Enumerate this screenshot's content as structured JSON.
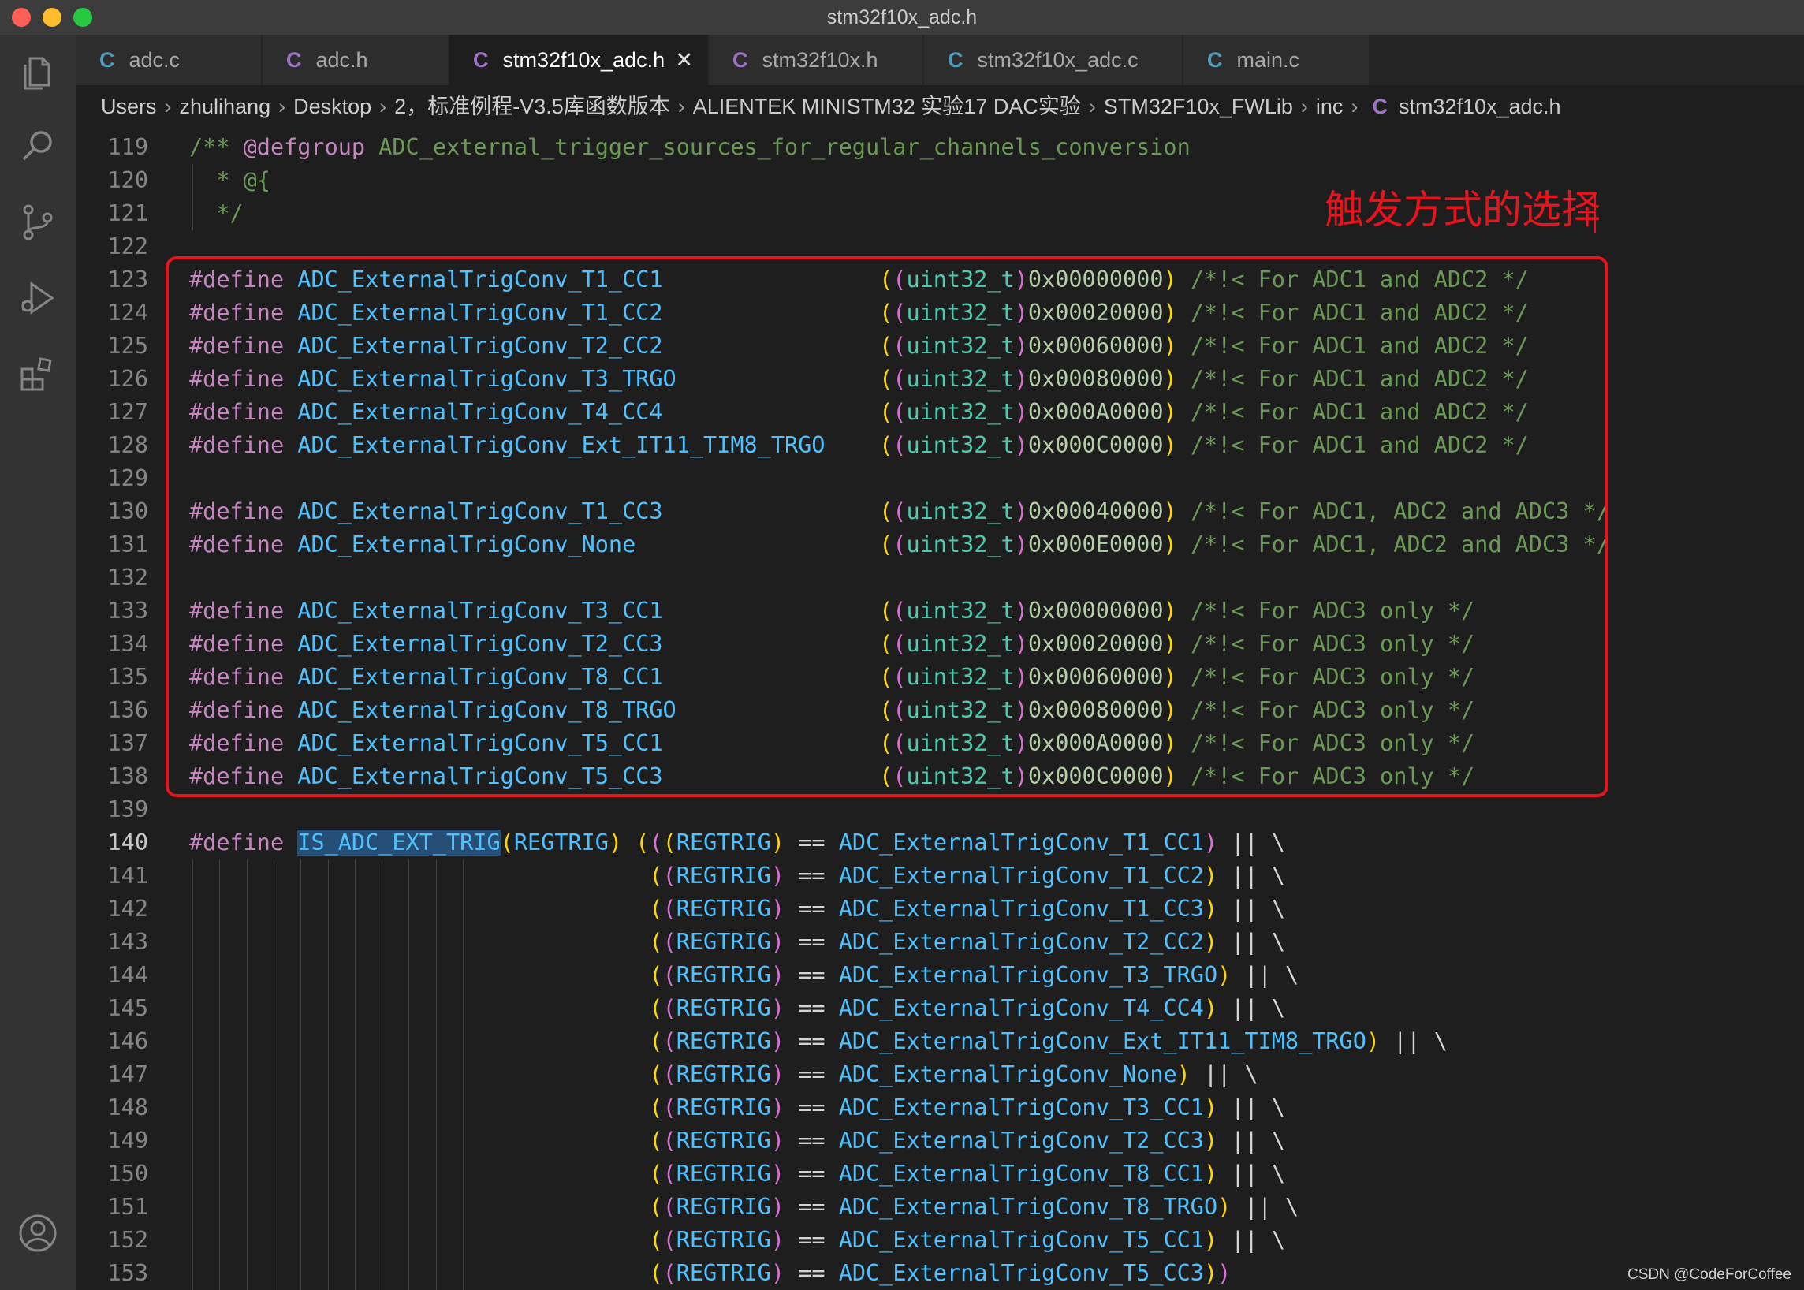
{
  "window": {
    "title": "stm32f10x_adc.h"
  },
  "colors": {
    "keyword": "#c586c0",
    "macro": "#4fc1ff",
    "type": "#4ec9b0",
    "number": "#b5cea8",
    "comment": "#6a9955",
    "paren": "#ffd700",
    "paren_inner": "#da70d6",
    "text": "#d4d4d4",
    "highlight": "#264f78",
    "annotation": "#e5141d"
  },
  "activity_bar": [
    {
      "icon": "files-icon"
    },
    {
      "icon": "search-icon"
    },
    {
      "icon": "source-control-icon"
    },
    {
      "icon": "run-debug-icon"
    },
    {
      "icon": "extensions-icon"
    },
    {
      "icon": "account-icon"
    }
  ],
  "tabs": [
    {
      "label": "adc.c",
      "icon": "C",
      "active": false
    },
    {
      "label": "adc.h",
      "icon": "C",
      "active": false
    },
    {
      "label": "stm32f10x_adc.h",
      "icon": "C",
      "active": true
    },
    {
      "label": "stm32f10x.h",
      "icon": "C",
      "active": false
    },
    {
      "label": "stm32f10x_adc.c",
      "icon": "C",
      "active": false
    },
    {
      "label": "main.c",
      "icon": "C",
      "active": false
    }
  ],
  "breadcrumb": [
    "Users",
    "zhulihang",
    "Desktop",
    "2，标准例程-V3.5库函数版本",
    "ALIENTEK MINISTM32 实验17 DAC实验",
    "STM32F10x_FWLib",
    "inc",
    "stm32f10x_adc.h"
  ],
  "annotation": "触发方式的选择",
  "watermark": "CSDN @CodeForCoffee",
  "current_line": 140,
  "lines": [
    {
      "n": 119,
      "t": "/** @defgroup ADC_external_trigger_sources_for_regular_channels_conversion"
    },
    {
      "n": 120,
      "t": "  * @{"
    },
    {
      "n": 121,
      "t": "  */"
    },
    {
      "n": 122,
      "t": ""
    },
    {
      "n": 123,
      "t": "#define ADC_ExternalTrigConv_T1_CC1                ((uint32_t)0x00000000) /*!< For ADC1 and ADC2 */"
    },
    {
      "n": 124,
      "t": "#define ADC_ExternalTrigConv_T1_CC2                ((uint32_t)0x00020000) /*!< For ADC1 and ADC2 */"
    },
    {
      "n": 125,
      "t": "#define ADC_ExternalTrigConv_T2_CC2                ((uint32_t)0x00060000) /*!< For ADC1 and ADC2 */"
    },
    {
      "n": 126,
      "t": "#define ADC_ExternalTrigConv_T3_TRGO               ((uint32_t)0x00080000) /*!< For ADC1 and ADC2 */"
    },
    {
      "n": 127,
      "t": "#define ADC_ExternalTrigConv_T4_CC4                ((uint32_t)0x000A0000) /*!< For ADC1 and ADC2 */"
    },
    {
      "n": 128,
      "t": "#define ADC_ExternalTrigConv_Ext_IT11_TIM8_TRGO    ((uint32_t)0x000C0000) /*!< For ADC1 and ADC2 */"
    },
    {
      "n": 129,
      "t": ""
    },
    {
      "n": 130,
      "t": "#define ADC_ExternalTrigConv_T1_CC3                ((uint32_t)0x00040000) /*!< For ADC1, ADC2 and ADC3 */"
    },
    {
      "n": 131,
      "t": "#define ADC_ExternalTrigConv_None                  ((uint32_t)0x000E0000) /*!< For ADC1, ADC2 and ADC3 */"
    },
    {
      "n": 132,
      "t": ""
    },
    {
      "n": 133,
      "t": "#define ADC_ExternalTrigConv_T3_CC1                ((uint32_t)0x00000000) /*!< For ADC3 only */"
    },
    {
      "n": 134,
      "t": "#define ADC_ExternalTrigConv_T2_CC3                ((uint32_t)0x00020000) /*!< For ADC3 only */"
    },
    {
      "n": 135,
      "t": "#define ADC_ExternalTrigConv_T8_CC1                ((uint32_t)0x00060000) /*!< For ADC3 only */"
    },
    {
      "n": 136,
      "t": "#define ADC_ExternalTrigConv_T8_TRGO               ((uint32_t)0x00080000) /*!< For ADC3 only */"
    },
    {
      "n": 137,
      "t": "#define ADC_ExternalTrigConv_T5_CC1                ((uint32_t)0x000A0000) /*!< For ADC3 only */"
    },
    {
      "n": 138,
      "t": "#define ADC_ExternalTrigConv_T5_CC3                ((uint32_t)0x000C0000) /*!< For ADC3 only */"
    },
    {
      "n": 139,
      "t": ""
    },
    {
      "n": 140,
      "t": "#define IS_ADC_EXT_TRIG(REGTRIG) (((REGTRIG) == ADC_ExternalTrigConv_T1_CC1) || \\"
    },
    {
      "n": 141,
      "t": "                                  ((REGTRIG) == ADC_ExternalTrigConv_T1_CC2) || \\"
    },
    {
      "n": 142,
      "t": "                                  ((REGTRIG) == ADC_ExternalTrigConv_T1_CC3) || \\"
    },
    {
      "n": 143,
      "t": "                                  ((REGTRIG) == ADC_ExternalTrigConv_T2_CC2) || \\"
    },
    {
      "n": 144,
      "t": "                                  ((REGTRIG) == ADC_ExternalTrigConv_T3_TRGO) || \\"
    },
    {
      "n": 145,
      "t": "                                  ((REGTRIG) == ADC_ExternalTrigConv_T4_CC4) || \\"
    },
    {
      "n": 146,
      "t": "                                  ((REGTRIG) == ADC_ExternalTrigConv_Ext_IT11_TIM8_TRGO) || \\"
    },
    {
      "n": 147,
      "t": "                                  ((REGTRIG) == ADC_ExternalTrigConv_None) || \\"
    },
    {
      "n": 148,
      "t": "                                  ((REGTRIG) == ADC_ExternalTrigConv_T3_CC1) || \\"
    },
    {
      "n": 149,
      "t": "                                  ((REGTRIG) == ADC_ExternalTrigConv_T2_CC3) || \\"
    },
    {
      "n": 150,
      "t": "                                  ((REGTRIG) == ADC_ExternalTrigConv_T8_CC1) || \\"
    },
    {
      "n": 151,
      "t": "                                  ((REGTRIG) == ADC_ExternalTrigConv_T8_TRGO) || \\"
    },
    {
      "n": 152,
      "t": "                                  ((REGTRIG) == ADC_ExternalTrigConv_T5_CC1) || \\"
    },
    {
      "n": 153,
      "t": "                                  ((REGTRIG) == ADC_ExternalTrigConv_T5_CC3))"
    }
  ]
}
